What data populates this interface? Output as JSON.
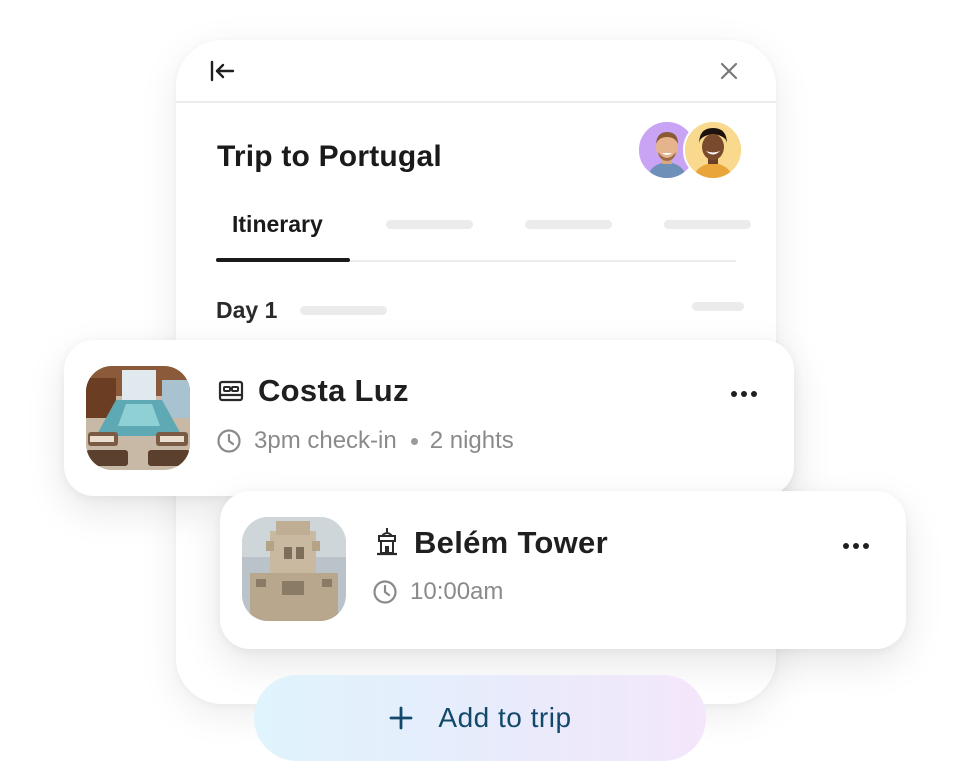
{
  "panel": {
    "title": "Trip to Portugal",
    "tabs": [
      {
        "label": "Itinerary",
        "active": true
      }
    ],
    "day_label": "Day 1",
    "icons": {
      "collapse": "collapse-left-icon",
      "close": "close-icon"
    }
  },
  "cards": {
    "hotel": {
      "name": "Costa Luz",
      "type_icon": "bed-icon",
      "time": "3pm check-in",
      "duration": "2 nights"
    },
    "tower": {
      "name": "Belém Tower",
      "type_icon": "landmark-icon",
      "time": "10:00am"
    }
  },
  "add_button": {
    "label": "Add to trip",
    "icon": "plus-icon"
  },
  "colors": {
    "accent_text": "#12496b",
    "gradient_start": "#dff4fd",
    "gradient_end": "#f4e6fb",
    "avatar_1_bg": "#c9a4f5",
    "avatar_2_bg": "#f8d98d"
  }
}
